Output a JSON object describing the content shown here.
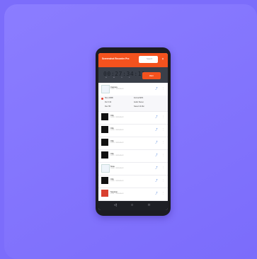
{
  "app": {
    "title": "Screenshot Recorder Pro",
    "search_placeholder": "Search",
    "close_label": "×"
  },
  "timer": {
    "digits": "00:27:34:11",
    "units": "H M S F",
    "record_label": "REC"
  },
  "recordings": [
    {
      "name": "Capture",
      "meta": "10:24 · 2023-05-12"
    },
    {
      "name": "Clip",
      "meta": "10:18 · 2023-05-12"
    },
    {
      "name": "Clip",
      "meta": "10:16 · 2023-05-12"
    },
    {
      "name": "Clip",
      "meta": "10:14 · 2023-05-12"
    },
    {
      "name": "Clip",
      "meta": "10:12 · 2023-05-12"
    },
    {
      "name": "Note",
      "meta": "10:09 · 2023-05-12"
    },
    {
      "name": "Clip",
      "meta": "10:05 · 2023-05-12"
    },
    {
      "name": "Session",
      "meta": "10:01 · 2023-05-12"
    }
  ],
  "detail": {
    "c1": "Size  24MB",
    "c2": "Dur   0:42",
    "c3": "Res   HD",
    "c4": "Format  MP4",
    "c5": "Audio  Stereo",
    "c6": "Saved  12 Mei"
  },
  "nav": {
    "back": "◁",
    "home": "○",
    "recents": "□"
  },
  "icons": {
    "share": "share-icon",
    "more": "more-icon"
  },
  "colors": {
    "accent": "#f4521e",
    "background": "#7c6dfb"
  }
}
